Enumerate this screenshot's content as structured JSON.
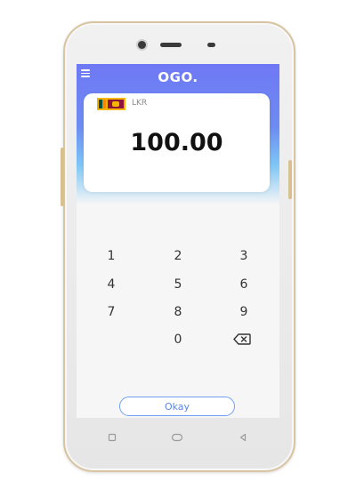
{
  "header": {
    "brand": "OGO."
  },
  "currency": {
    "code": "LKR",
    "amount": "100.00"
  },
  "keypad": {
    "k1": "1",
    "k2": "2",
    "k3": "3",
    "k4": "4",
    "k5": "5",
    "k6": "6",
    "k7": "7",
    "k8": "8",
    "k9": "9",
    "k0": "0"
  },
  "actions": {
    "okay_label": "Okay"
  },
  "colors": {
    "header_gradient_top": "#6f78f4",
    "header_gradient_bottom": "#7ec6f6",
    "accent": "#5a88e6"
  },
  "icons": {
    "menu": "hamburger-icon",
    "backspace": "backspace-icon",
    "nav_recent": "square-icon",
    "nav_home": "circle-icon",
    "nav_back": "triangle-icon"
  }
}
